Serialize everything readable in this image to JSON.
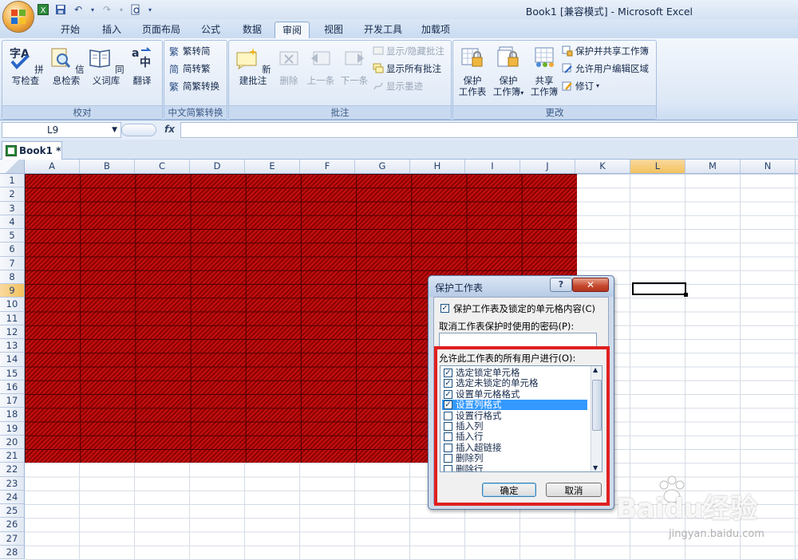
{
  "window": {
    "title": "Book1  [兼容模式] - Microsoft Excel"
  },
  "tabs": [
    "开始",
    "插入",
    "页面布局",
    "公式",
    "数据",
    "审阅",
    "视图",
    "开发工具",
    "加载项"
  ],
  "active_tab": "审阅",
  "ribbon": {
    "proofing": {
      "label": "校对",
      "buttons": [
        "拼写检查",
        "信息检索",
        "同义词库",
        "翻译"
      ]
    },
    "chinese": {
      "label": "中文简繁转换",
      "buttons": [
        "繁转简",
        "简转繁",
        "简繁转换"
      ]
    },
    "comments": {
      "label": "批注",
      "new": "新建批注",
      "delete": "删除",
      "prev": "上一条",
      "next": "下一条",
      "show_hide": "显示/隐藏批注",
      "show_all": "显示所有批注",
      "show_ink": "显示墨迹"
    },
    "changes": {
      "label": "更改",
      "protect_sheet": [
        "保护",
        "工作表"
      ],
      "protect_book": [
        "保护",
        "工作簿"
      ],
      "share_book": [
        "共享",
        "工作簿"
      ],
      "protect_share": "保护并共享工作簿",
      "allow_edit": "允许用户编辑区域",
      "track": "修订"
    }
  },
  "formula_bar": {
    "name_box": "L9",
    "fx": "fx",
    "formula": ""
  },
  "workbook_tab": "Book1 *",
  "columns": [
    "A",
    "B",
    "C",
    "D",
    "E",
    "F",
    "G",
    "H",
    "I",
    "J",
    "K",
    "L",
    "M",
    "N"
  ],
  "rows": [
    "1",
    "2",
    "3",
    "4",
    "5",
    "6",
    "7",
    "8",
    "9",
    "10",
    "11",
    "12",
    "13",
    "14",
    "15",
    "16",
    "17",
    "18",
    "19",
    "20",
    "21",
    "22",
    "23",
    "24",
    "25",
    "26",
    "27",
    "28"
  ],
  "selected": {
    "column": "L",
    "row": "9"
  },
  "dialog": {
    "title": "保护工作表",
    "help": "?",
    "close": "✕",
    "protect_label": "保护工作表及锁定的单元格内容(C)",
    "protect_checked": true,
    "password_label": "取消工作表保护时使用的密码(P):",
    "password": "",
    "allow_label": "允许此工作表的所有用户进行(O):",
    "permissions": [
      {
        "label": "选定锁定单元格",
        "checked": true
      },
      {
        "label": "选定未锁定的单元格",
        "checked": true
      },
      {
        "label": "设置单元格格式",
        "checked": true
      },
      {
        "label": "设置列格式",
        "checked": true
      },
      {
        "label": "设置行格式",
        "checked": false
      },
      {
        "label": "插入列",
        "checked": false
      },
      {
        "label": "插入行",
        "checked": false
      },
      {
        "label": "插入超链接",
        "checked": false
      },
      {
        "label": "删除列",
        "checked": false
      },
      {
        "label": "删除行",
        "checked": false
      }
    ],
    "highlighted_index": 3,
    "ok": "确定",
    "cancel": "取消"
  },
  "watermark": {
    "logo": "Baidu经验",
    "sub": "jingyan.baidu.com"
  },
  "colors": {
    "accent": "#e02020",
    "fill": "#b00000",
    "selection": "#3399ff"
  }
}
